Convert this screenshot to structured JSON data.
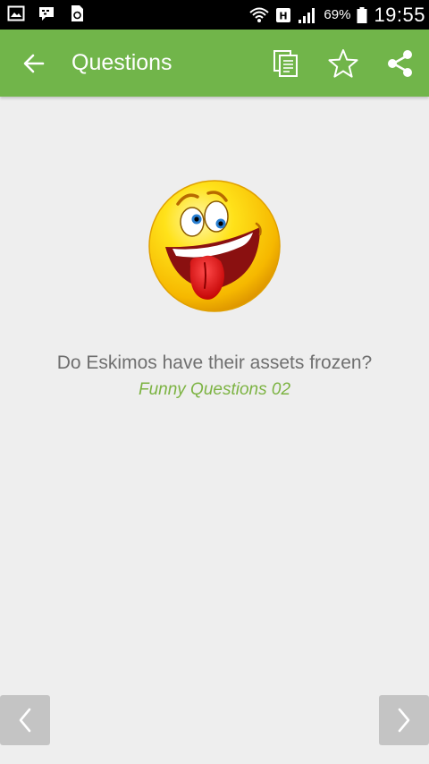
{
  "status_bar": {
    "left_icons": [
      "gallery-icon",
      "bbm-icon",
      "recycle-icon"
    ],
    "right_icons": [
      "wifi-icon",
      "data-icon",
      "signal-icon",
      "battery-icon"
    ],
    "battery": "69%",
    "time": "19:55"
  },
  "app_bar": {
    "title": "Questions",
    "back_icon": "arrow-left-icon",
    "actions": [
      "copy-icon",
      "star-icon",
      "share-icon"
    ],
    "color": "#71b54a"
  },
  "content": {
    "image_icon": "crazy-face-emoji-icon",
    "question": "Do Eskimos have their assets frozen?",
    "category": "Funny Questions 02",
    "category_color": "#7cb342"
  },
  "nav": {
    "prev_icon": "chevron-left-icon",
    "next_icon": "chevron-right-icon"
  }
}
